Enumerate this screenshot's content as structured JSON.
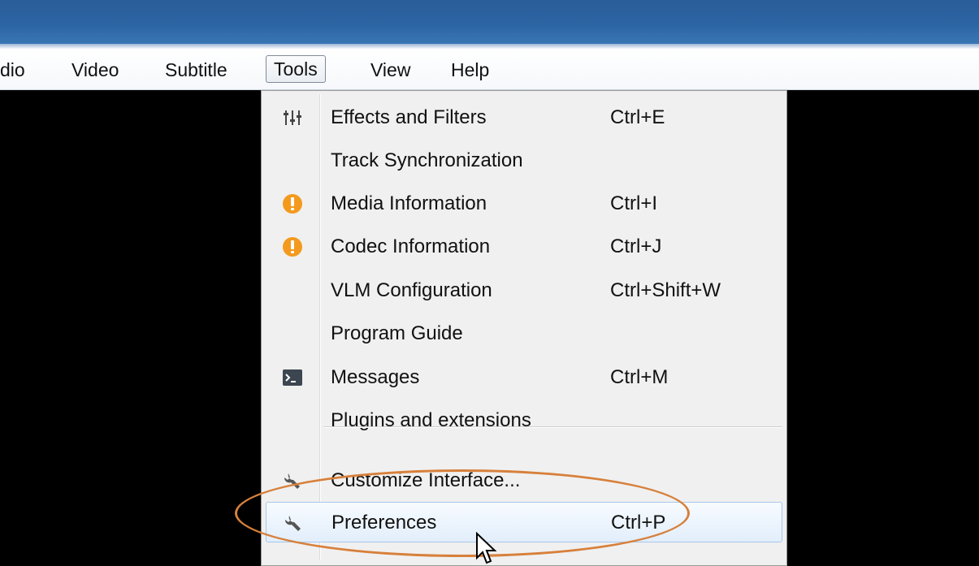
{
  "menubar": {
    "items": [
      {
        "label": "dio"
      },
      {
        "label": "Video"
      },
      {
        "label": "Subtitle"
      },
      {
        "label": "Tools"
      },
      {
        "label": "View"
      },
      {
        "label": "Help"
      }
    ],
    "active": "Tools"
  },
  "tools_menu": {
    "items": [
      {
        "label": "Effects and Filters",
        "shortcut": "Ctrl+E",
        "icon": "equalizer-icon"
      },
      {
        "label": "Track Synchronization",
        "shortcut": "",
        "icon": ""
      },
      {
        "label": "Media Information",
        "shortcut": "Ctrl+I",
        "icon": "info-icon"
      },
      {
        "label": "Codec Information",
        "shortcut": "Ctrl+J",
        "icon": "info-icon"
      },
      {
        "label": "VLM Configuration",
        "shortcut": "Ctrl+Shift+W",
        "icon": ""
      },
      {
        "label": "Program Guide",
        "shortcut": "",
        "icon": ""
      },
      {
        "label": "Messages",
        "shortcut": "Ctrl+M",
        "icon": "terminal-icon"
      },
      {
        "label": "Plugins and extensions",
        "shortcut": "",
        "icon": ""
      },
      {
        "label": "Customize Interface...",
        "shortcut": "",
        "icon": "wrench-icon"
      },
      {
        "label": "Preferences",
        "shortcut": "Ctrl+P",
        "icon": "wrench-icon"
      }
    ],
    "highlighted": "Preferences"
  },
  "colors": {
    "titlebar": "#2c64a3",
    "annotation_oval": "#d7803b",
    "info_icon": "#f39a1e",
    "highlight_border": "#a9c7ea"
  }
}
